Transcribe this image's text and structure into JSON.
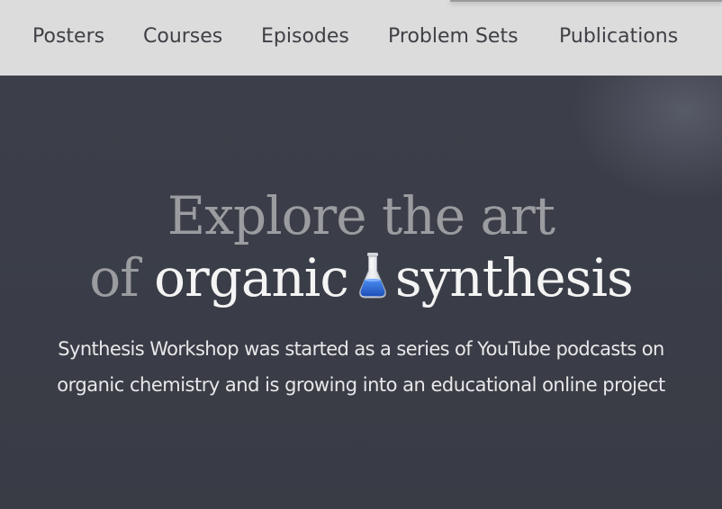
{
  "nav": {
    "items": [
      {
        "label": "Posters"
      },
      {
        "label": "Courses"
      },
      {
        "label": "Episodes"
      },
      {
        "label": "Problem Sets"
      },
      {
        "label": "Publications"
      }
    ]
  },
  "hero": {
    "headline_line1": "Explore the art",
    "headline_line2_prefix": "of",
    "headline_line2_word1": "organic",
    "headline_icon": "flask-icon",
    "headline_line2_word2": "synthesis",
    "description_line1": "Synthesis Workshop was started as a series of YouTube podcasts on",
    "description_line2": "organic chemistry and is growing into an educational online project"
  },
  "colors": {
    "nav_background": "#dcdcdd",
    "hero_background": "#3b3f4a",
    "headline_muted": "#9b9ca0",
    "headline_bright": "#f4f4f4",
    "flask_liquid": "#2f6fd6"
  }
}
